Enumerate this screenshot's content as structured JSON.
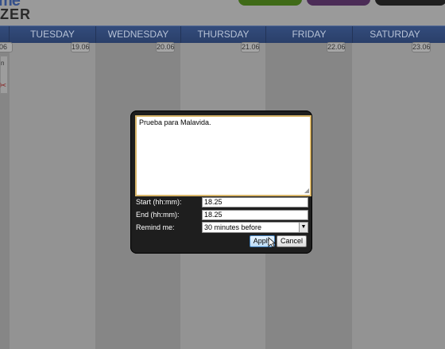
{
  "header": {
    "logo_top": "me",
    "logo_bottom": "ZER"
  },
  "days": [
    {
      "name": "TUESDAY",
      "date": "19.06"
    },
    {
      "name": "WEDNESDAY",
      "date": "20.06"
    },
    {
      "name": "THURSDAY",
      "date": "21.06"
    },
    {
      "name": "FRIDAY",
      "date": "22.06"
    },
    {
      "name": "SATURDAY",
      "date": "23.06"
    }
  ],
  "left_date": "06",
  "left_panel_text": "n",
  "dialog": {
    "note_text": "Prueba para Malavida.",
    "start_label": "Start (hh:mm):",
    "start_value": "18.25",
    "end_label": "End (hh:mm):",
    "end_value": "18.25",
    "remind_label": "Remind me:",
    "remind_value": "30 minutes before",
    "apply_label": "Apply",
    "cancel_label": "Cancel"
  },
  "colors": {
    "header_blue": "#2f4674",
    "textarea_border": "#d9b66a",
    "dialog_bg": "#1e1e1e"
  }
}
